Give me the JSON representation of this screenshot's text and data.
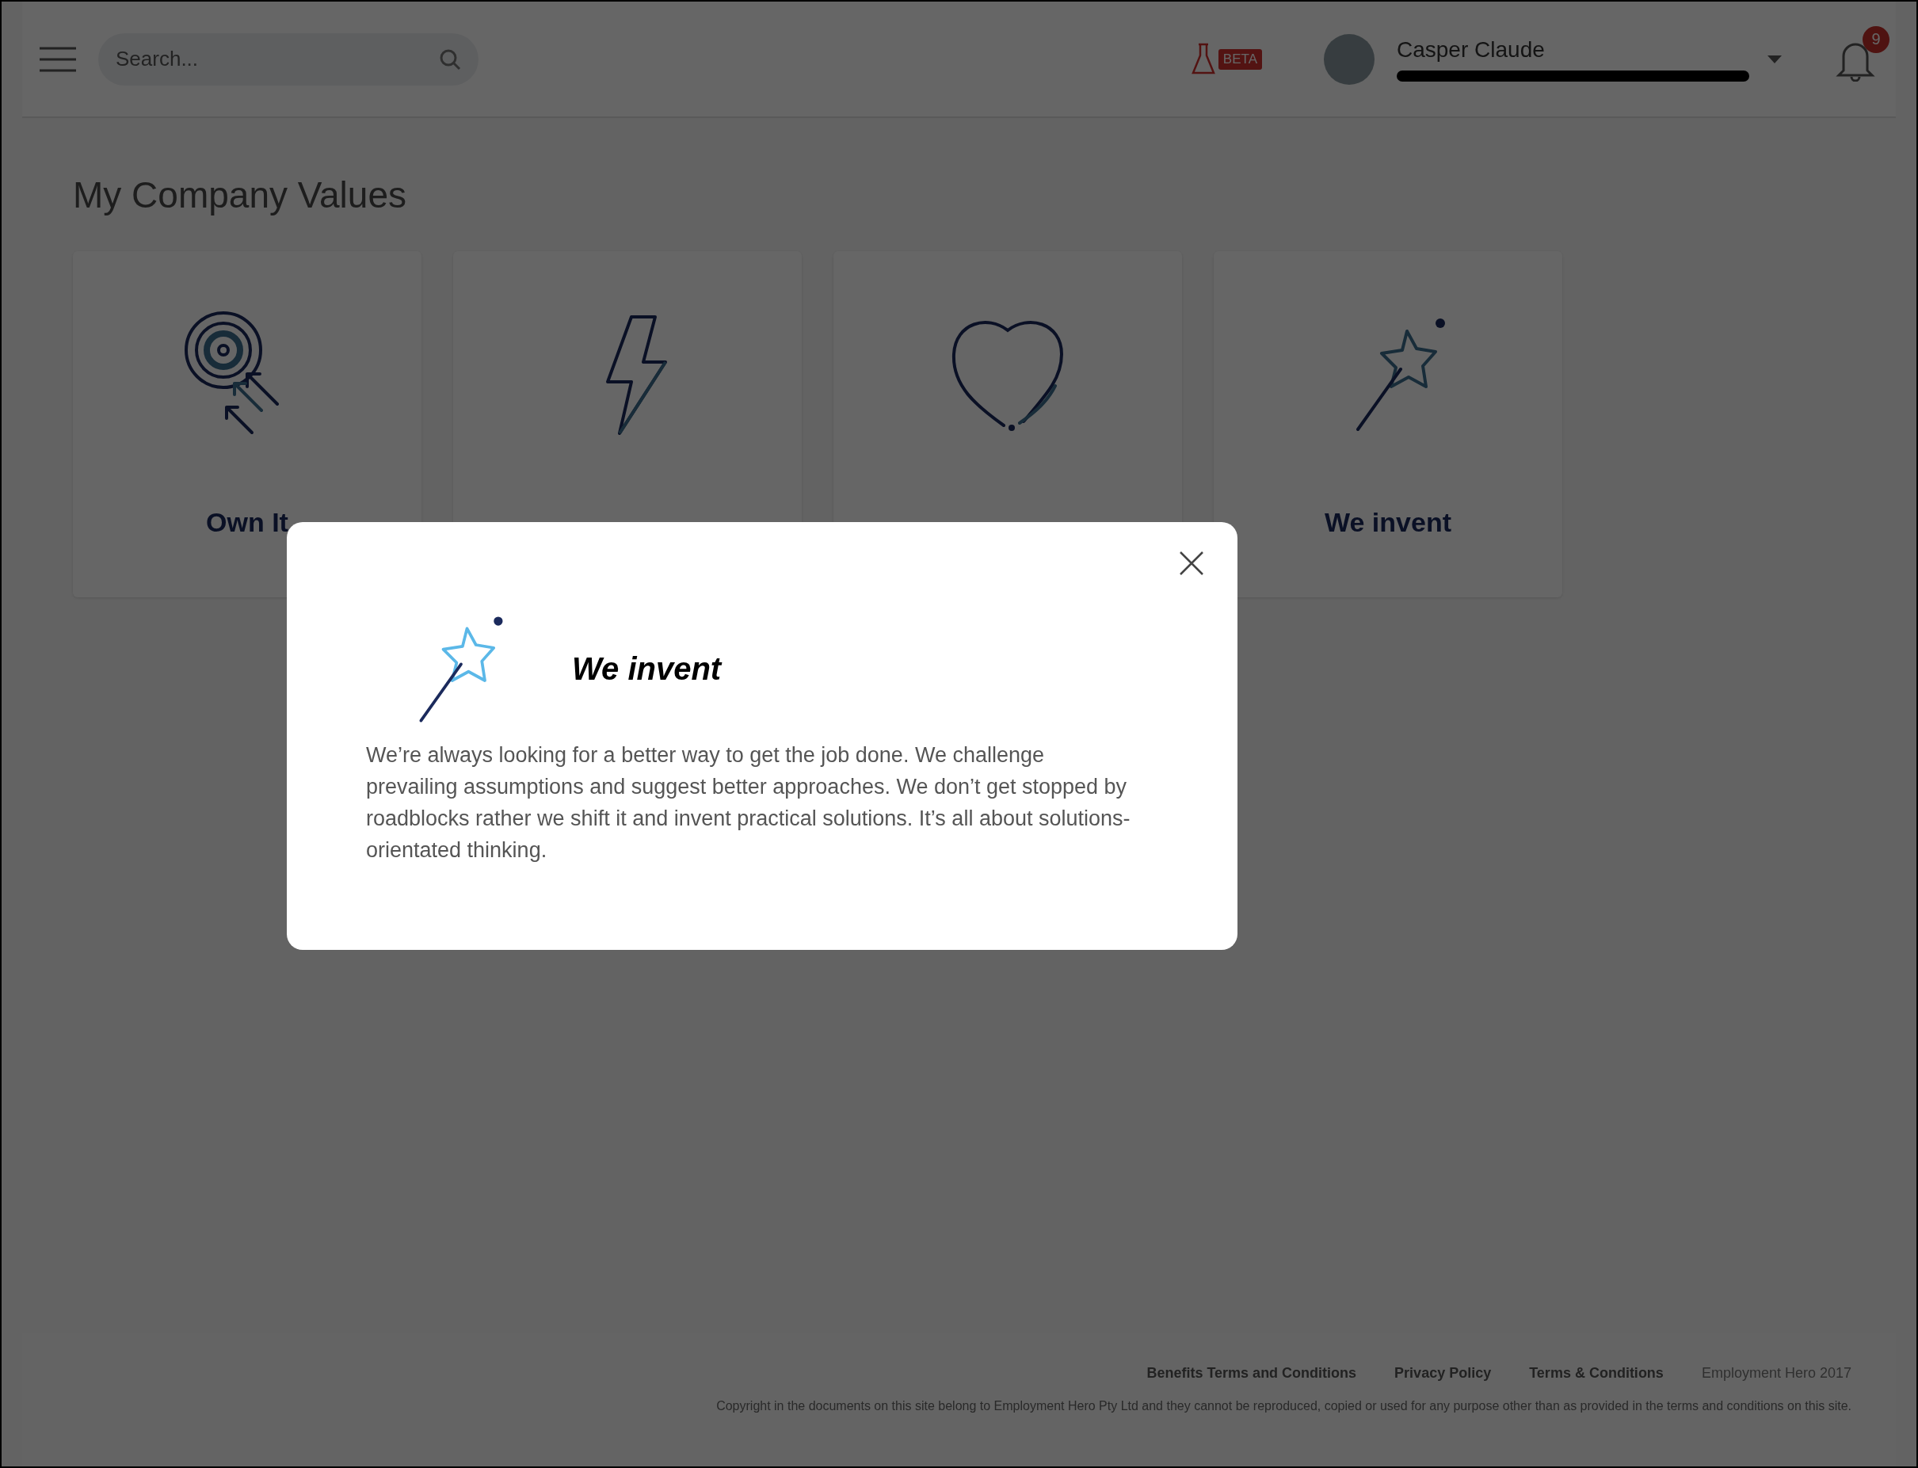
{
  "header": {
    "search": {
      "placeholder": "Search..."
    },
    "beta_badge": "BETA",
    "user": {
      "name": "Casper Claude"
    },
    "notifications": {
      "count": "9"
    }
  },
  "page": {
    "title": "My Company Values"
  },
  "values": [
    {
      "title": "Own It",
      "kind": "target"
    },
    {
      "kind": "bolt"
    },
    {
      "kind": "heart"
    },
    {
      "title": "We invent",
      "kind": "wand"
    }
  ],
  "modal": {
    "kind": "wand",
    "title": "We invent",
    "body": "We’re always looking for a better way to get the job done. We challenge prevailing assumptions and suggest better approaches. We don’t get stopped by roadblocks rather we shift it and invent practical solutions. It’s all about solutions-orientated thinking."
  },
  "footer": {
    "links": [
      "Benefits Terms and Conditions",
      "Privacy Policy",
      "Terms & Conditions"
    ],
    "brand": "Employment Hero 2017",
    "copyright": "Copyright in the documents on this site belong to Employment Hero Pty Ltd and they cannot be reproduced, copied or used for any purpose other than as provided in the terms and conditions on this site."
  }
}
